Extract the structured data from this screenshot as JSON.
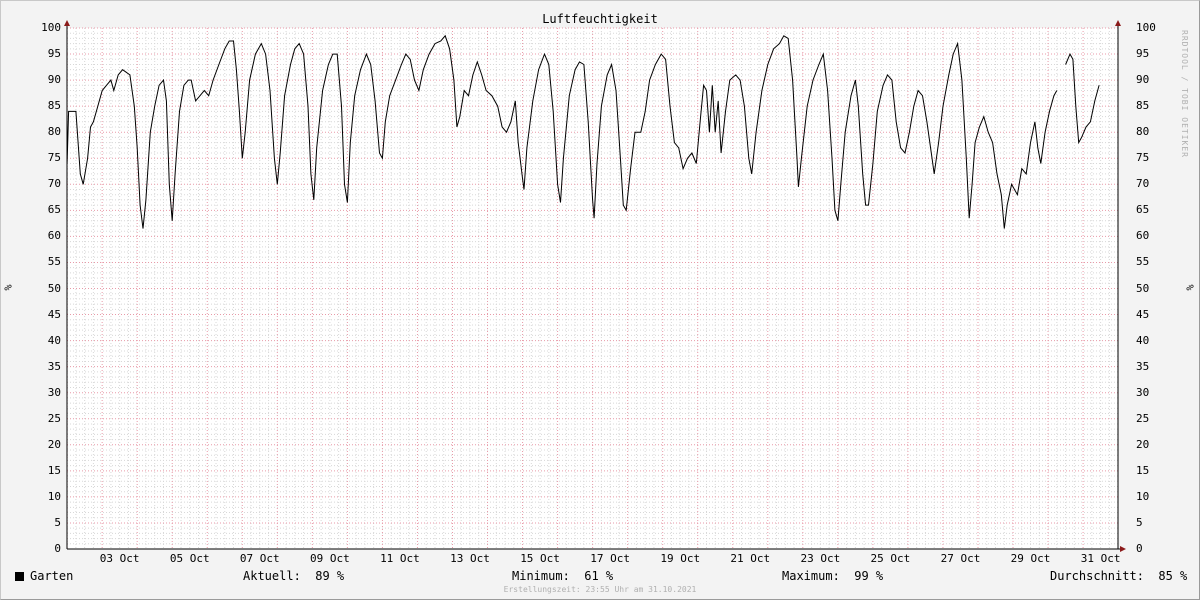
{
  "chart_data": {
    "type": "line",
    "title": "Luftfeuchtigkeit",
    "ylabel_left": "%",
    "ylabel_right": "%",
    "ylim": [
      0,
      100
    ],
    "ytick_step": 5,
    "xlim": [
      "2021-10-01T23:55",
      "2021-10-31T23:55"
    ],
    "xticks": [
      {
        "date": "2021-10-03",
        "label": "03 Oct"
      },
      {
        "date": "2021-10-05",
        "label": "05 Oct"
      },
      {
        "date": "2021-10-07",
        "label": "07 Oct"
      },
      {
        "date": "2021-10-09",
        "label": "09 Oct"
      },
      {
        "date": "2021-10-11",
        "label": "11 Oct"
      },
      {
        "date": "2021-10-13",
        "label": "13 Oct"
      },
      {
        "date": "2021-10-15",
        "label": "15 Oct"
      },
      {
        "date": "2021-10-17",
        "label": "17 Oct"
      },
      {
        "date": "2021-10-19",
        "label": "19 Oct"
      },
      {
        "date": "2021-10-21",
        "label": "21 Oct"
      },
      {
        "date": "2021-10-23",
        "label": "23 Oct"
      },
      {
        "date": "2021-10-25",
        "label": "25 Oct"
      },
      {
        "date": "2021-10-27",
        "label": "27 Oct"
      },
      {
        "date": "2021-10-29",
        "label": "29 Oct"
      },
      {
        "date": "2021-10-31",
        "label": "31 Oct"
      }
    ],
    "grid": true,
    "series": [
      {
        "name": "Garten",
        "color": "#000000",
        "points": [
          [
            "2021-10-02T00:00",
            74
          ],
          [
            "2021-10-02T01:00",
            84
          ],
          [
            "2021-10-02T06:00",
            84
          ],
          [
            "2021-10-02T09:00",
            72
          ],
          [
            "2021-10-02T11:00",
            70
          ],
          [
            "2021-10-02T14:00",
            75
          ],
          [
            "2021-10-02T16:00",
            81
          ],
          [
            "2021-10-02T18:00",
            82
          ],
          [
            "2021-10-02T21:00",
            85
          ],
          [
            "2021-10-03T00:00",
            88
          ],
          [
            "2021-10-03T03:00",
            89
          ],
          [
            "2021-10-03T06:00",
            90
          ],
          [
            "2021-10-03T08:00",
            88
          ],
          [
            "2021-10-03T11:00",
            91
          ],
          [
            "2021-10-03T14:00",
            92
          ],
          [
            "2021-10-03T19:00",
            91
          ],
          [
            "2021-10-03T22:00",
            85
          ],
          [
            "2021-10-04T00:00",
            77
          ],
          [
            "2021-10-04T02:00",
            66
          ],
          [
            "2021-10-04T04:00",
            61.5
          ],
          [
            "2021-10-04T06:00",
            67
          ],
          [
            "2021-10-04T09:00",
            80
          ],
          [
            "2021-10-04T12:00",
            85
          ],
          [
            "2021-10-04T15:00",
            89
          ],
          [
            "2021-10-04T18:00",
            90
          ],
          [
            "2021-10-04T20:00",
            86
          ],
          [
            "2021-10-04T22:00",
            70
          ],
          [
            "2021-10-05T00:00",
            63
          ],
          [
            "2021-10-05T02:00",
            72
          ],
          [
            "2021-10-05T05:00",
            84
          ],
          [
            "2021-10-05T08:00",
            89
          ],
          [
            "2021-10-05T11:00",
            90
          ],
          [
            "2021-10-05T13:00",
            90
          ],
          [
            "2021-10-05T16:00",
            86
          ],
          [
            "2021-10-05T19:00",
            87
          ],
          [
            "2021-10-05T22:00",
            88
          ],
          [
            "2021-10-06T01:00",
            87
          ],
          [
            "2021-10-06T04:00",
            90
          ],
          [
            "2021-10-06T08:00",
            93
          ],
          [
            "2021-10-06T12:00",
            96
          ],
          [
            "2021-10-06T15:00",
            97.5
          ],
          [
            "2021-10-06T18:00",
            97.5
          ],
          [
            "2021-10-06T20:00",
            92
          ],
          [
            "2021-10-06T22:00",
            84
          ],
          [
            "2021-10-07T00:00",
            75
          ],
          [
            "2021-10-07T02:00",
            80
          ],
          [
            "2021-10-07T05:00",
            90
          ],
          [
            "2021-10-07T09:00",
            95
          ],
          [
            "2021-10-07T13:00",
            97
          ],
          [
            "2021-10-07T16:00",
            95
          ],
          [
            "2021-10-07T19:00",
            88
          ],
          [
            "2021-10-07T22:00",
            75
          ],
          [
            "2021-10-08T00:00",
            70
          ],
          [
            "2021-10-08T02:00",
            76
          ],
          [
            "2021-10-08T05:00",
            87
          ],
          [
            "2021-10-08T09:00",
            93
          ],
          [
            "2021-10-08T12:00",
            96
          ],
          [
            "2021-10-08T15:00",
            97
          ],
          [
            "2021-10-08T18:00",
            95
          ],
          [
            "2021-10-08T21:00",
            85
          ],
          [
            "2021-10-08T23:00",
            72
          ],
          [
            "2021-10-09T01:00",
            67
          ],
          [
            "2021-10-09T03:00",
            77
          ],
          [
            "2021-10-09T07:00",
            88
          ],
          [
            "2021-10-09T11:00",
            93
          ],
          [
            "2021-10-09T14:00",
            95
          ],
          [
            "2021-10-09T17:00",
            95
          ],
          [
            "2021-10-09T20:00",
            85
          ],
          [
            "2021-10-09T22:00",
            70
          ],
          [
            "2021-10-10T00:00",
            66.5
          ],
          [
            "2021-10-10T02:00",
            78
          ],
          [
            "2021-10-10T05:00",
            87
          ],
          [
            "2021-10-10T09:00",
            92
          ],
          [
            "2021-10-10T13:00",
            95
          ],
          [
            "2021-10-10T16:00",
            93
          ],
          [
            "2021-10-10T19:00",
            86
          ],
          [
            "2021-10-10T22:00",
            76
          ],
          [
            "2021-10-11T00:00",
            75
          ],
          [
            "2021-10-11T02:00",
            82
          ],
          [
            "2021-10-11T05:00",
            87
          ],
          [
            "2021-10-11T09:00",
            90
          ],
          [
            "2021-10-11T13:00",
            93
          ],
          [
            "2021-10-11T16:00",
            95
          ],
          [
            "2021-10-11T19:00",
            94
          ],
          [
            "2021-10-11T22:00",
            90
          ],
          [
            "2021-10-12T01:00",
            88
          ],
          [
            "2021-10-12T04:00",
            92
          ],
          [
            "2021-10-12T08:00",
            95
          ],
          [
            "2021-10-12T12:00",
            97
          ],
          [
            "2021-10-12T16:00",
            97.5
          ],
          [
            "2021-10-12T19:00",
            98.5
          ],
          [
            "2021-10-12T22:00",
            96
          ],
          [
            "2021-10-13T01:00",
            90
          ],
          [
            "2021-10-13T03:00",
            81
          ],
          [
            "2021-10-13T05:00",
            83
          ],
          [
            "2021-10-13T08:00",
            88
          ],
          [
            "2021-10-13T11:00",
            87
          ],
          [
            "2021-10-13T14:00",
            91
          ],
          [
            "2021-10-13T17:00",
            93.5
          ],
          [
            "2021-10-13T20:00",
            91
          ],
          [
            "2021-10-13T23:00",
            88
          ],
          [
            "2021-10-14T03:00",
            87
          ],
          [
            "2021-10-14T07:00",
            85
          ],
          [
            "2021-10-14T10:00",
            81
          ],
          [
            "2021-10-14T13:00",
            80
          ],
          [
            "2021-10-14T16:00",
            82
          ],
          [
            "2021-10-14T19:00",
            86
          ],
          [
            "2021-10-14T21:00",
            78
          ],
          [
            "2021-10-15T00:00",
            71
          ],
          [
            "2021-10-15T01:00",
            69
          ],
          [
            "2021-10-15T03:00",
            77
          ],
          [
            "2021-10-15T07:00",
            86
          ],
          [
            "2021-10-15T11:00",
            92
          ],
          [
            "2021-10-15T15:00",
            95
          ],
          [
            "2021-10-15T18:00",
            93
          ],
          [
            "2021-10-15T21:00",
            84
          ],
          [
            "2021-10-16T00:00",
            70
          ],
          [
            "2021-10-16T02:00",
            66.5
          ],
          [
            "2021-10-16T04:00",
            75
          ],
          [
            "2021-10-16T08:00",
            87
          ],
          [
            "2021-10-16T12:00",
            92
          ],
          [
            "2021-10-16T15:00",
            93.5
          ],
          [
            "2021-10-16T18:00",
            93
          ],
          [
            "2021-10-16T21:00",
            82
          ],
          [
            "2021-10-17T00:00",
            67
          ],
          [
            "2021-10-17T01:00",
            63.5
          ],
          [
            "2021-10-17T03:00",
            74
          ],
          [
            "2021-10-17T06:00",
            85
          ],
          [
            "2021-10-17T10:00",
            91
          ],
          [
            "2021-10-17T13:00",
            93
          ],
          [
            "2021-10-17T16:00",
            88
          ],
          [
            "2021-10-17T19:00",
            75
          ],
          [
            "2021-10-17T21:00",
            66
          ],
          [
            "2021-10-17T23:00",
            65
          ],
          [
            "2021-10-18T02:00",
            73
          ],
          [
            "2021-10-18T05:00",
            80
          ],
          [
            "2021-10-18T09:00",
            80
          ],
          [
            "2021-10-18T12:00",
            84
          ],
          [
            "2021-10-18T15:00",
            90
          ],
          [
            "2021-10-18T19:00",
            93
          ],
          [
            "2021-10-18T23:00",
            95
          ],
          [
            "2021-10-19T02:00",
            94
          ],
          [
            "2021-10-19T05:00",
            85
          ],
          [
            "2021-10-19T08:00",
            78
          ],
          [
            "2021-10-19T11:00",
            77
          ],
          [
            "2021-10-19T14:00",
            73
          ],
          [
            "2021-10-19T17:00",
            75
          ],
          [
            "2021-10-19T20:00",
            76
          ],
          [
            "2021-10-19T23:00",
            74
          ],
          [
            "2021-10-20T02:00",
            83
          ],
          [
            "2021-10-20T04:00",
            89
          ],
          [
            "2021-10-20T06:00",
            88
          ],
          [
            "2021-10-20T08:00",
            80
          ],
          [
            "2021-10-20T10:00",
            89
          ],
          [
            "2021-10-20T12:00",
            80
          ],
          [
            "2021-10-20T14:00",
            86
          ],
          [
            "2021-10-20T16:00",
            76
          ],
          [
            "2021-10-20T19:00",
            84
          ],
          [
            "2021-10-20T22:00",
            90
          ],
          [
            "2021-10-21T02:00",
            91
          ],
          [
            "2021-10-21T05:00",
            90
          ],
          [
            "2021-10-21T08:00",
            85
          ],
          [
            "2021-10-21T11:00",
            75
          ],
          [
            "2021-10-21T13:00",
            72
          ],
          [
            "2021-10-21T16:00",
            80
          ],
          [
            "2021-10-21T20:00",
            88
          ],
          [
            "2021-10-22T00:00",
            93
          ],
          [
            "2021-10-22T04:00",
            96
          ],
          [
            "2021-10-22T08:00",
            97
          ],
          [
            "2021-10-22T11:00",
            98.5
          ],
          [
            "2021-10-22T14:00",
            98
          ],
          [
            "2021-10-22T17:00",
            90
          ],
          [
            "2021-10-22T20:00",
            75
          ],
          [
            "2021-10-22T21:00",
            69.5
          ],
          [
            "2021-10-22T23:00",
            75
          ],
          [
            "2021-10-23T03:00",
            85
          ],
          [
            "2021-10-23T07:00",
            90
          ],
          [
            "2021-10-23T11:00",
            93
          ],
          [
            "2021-10-23T14:00",
            95
          ],
          [
            "2021-10-23T17:00",
            88
          ],
          [
            "2021-10-23T20:00",
            75
          ],
          [
            "2021-10-23T22:00",
            65
          ],
          [
            "2021-10-24T00:00",
            63
          ],
          [
            "2021-10-24T02:00",
            70
          ],
          [
            "2021-10-24T05:00",
            80
          ],
          [
            "2021-10-24T09:00",
            87
          ],
          [
            "2021-10-24T12:00",
            90
          ],
          [
            "2021-10-24T14:00",
            85
          ],
          [
            "2021-10-24T17:00",
            72
          ],
          [
            "2021-10-24T19:00",
            66
          ],
          [
            "2021-10-24T21:00",
            66
          ],
          [
            "2021-10-25T00:00",
            74
          ],
          [
            "2021-10-25T03:00",
            84
          ],
          [
            "2021-10-25T07:00",
            89
          ],
          [
            "2021-10-25T10:00",
            91
          ],
          [
            "2021-10-25T13:00",
            90
          ],
          [
            "2021-10-25T16:00",
            82
          ],
          [
            "2021-10-25T19:00",
            77
          ],
          [
            "2021-10-25T22:00",
            76
          ],
          [
            "2021-10-26T01:00",
            80
          ],
          [
            "2021-10-26T04:00",
            85
          ],
          [
            "2021-10-26T07:00",
            88
          ],
          [
            "2021-10-26T10:00",
            87
          ],
          [
            "2021-10-26T13:00",
            82
          ],
          [
            "2021-10-26T16:00",
            76
          ],
          [
            "2021-10-26T18:00",
            72
          ],
          [
            "2021-10-26T21:00",
            78
          ],
          [
            "2021-10-27T00:00",
            85
          ],
          [
            "2021-10-27T04:00",
            91
          ],
          [
            "2021-10-27T07:00",
            95
          ],
          [
            "2021-10-27T10:00",
            97
          ],
          [
            "2021-10-27T13:00",
            90
          ],
          [
            "2021-10-27T16:00",
            75
          ],
          [
            "2021-10-27T18:00",
            63.5
          ],
          [
            "2021-10-27T20:00",
            70
          ],
          [
            "2021-10-27T22:00",
            78
          ],
          [
            "2021-10-28T01:00",
            81
          ],
          [
            "2021-10-28T04:00",
            83
          ],
          [
            "2021-10-28T07:00",
            80
          ],
          [
            "2021-10-28T10:00",
            78
          ],
          [
            "2021-10-28T13:00",
            72
          ],
          [
            "2021-10-28T16:00",
            68
          ],
          [
            "2021-10-28T18:00",
            61.5
          ],
          [
            "2021-10-28T20:00",
            66
          ],
          [
            "2021-10-28T23:00",
            70
          ],
          [
            "2021-10-29T03:00",
            68
          ],
          [
            "2021-10-29T06:00",
            73
          ],
          [
            "2021-10-29T09:00",
            72
          ],
          [
            "2021-10-29T12:00",
            78
          ],
          [
            "2021-10-29T15:00",
            82
          ],
          [
            "2021-10-29T17:00",
            77
          ],
          [
            "2021-10-29T19:00",
            74
          ],
          [
            "2021-10-29T22:00",
            80
          ],
          [
            "2021-10-30T01:00",
            84
          ],
          [
            "2021-10-30T04:00",
            87
          ],
          [
            "2021-10-30T06:00",
            88
          ],
          [
            "2021-10-30T09:00",
            null
          ],
          [
            "2021-10-30T12:00",
            93
          ],
          [
            "2021-10-30T15:00",
            95
          ],
          [
            "2021-10-30T17:00",
            94
          ],
          [
            "2021-10-30T19:00",
            85
          ],
          [
            "2021-10-30T21:00",
            78
          ],
          [
            "2021-10-30T23:00",
            79
          ],
          [
            "2021-10-31T02:00",
            81
          ],
          [
            "2021-10-31T05:00",
            82
          ],
          [
            "2021-10-31T08:00",
            86
          ],
          [
            "2021-10-31T11:00",
            89
          ]
        ]
      }
    ]
  },
  "legend": {
    "series_name": "Garten",
    "current_label": "Aktuell:",
    "current_value": "89 %",
    "min_label": "Minimum:",
    "min_value": "61 %",
    "max_label": "Maximum:",
    "max_value": "99 %",
    "avg_label": "Durchschnitt:",
    "avg_value": "85 %"
  },
  "watermark": "RRDTOOL / TOBI OETIKER",
  "created_text": "Erstellungszeit: 23:55 Uhr am 31.10.2021",
  "colors": {
    "background": "#f3f3f3",
    "plot_background": "#ffffff",
    "major_grid": "#e89aa8",
    "minor_grid": "#d8d8d8",
    "axis_arrow": "#8b1a1a",
    "line": "#000000"
  }
}
